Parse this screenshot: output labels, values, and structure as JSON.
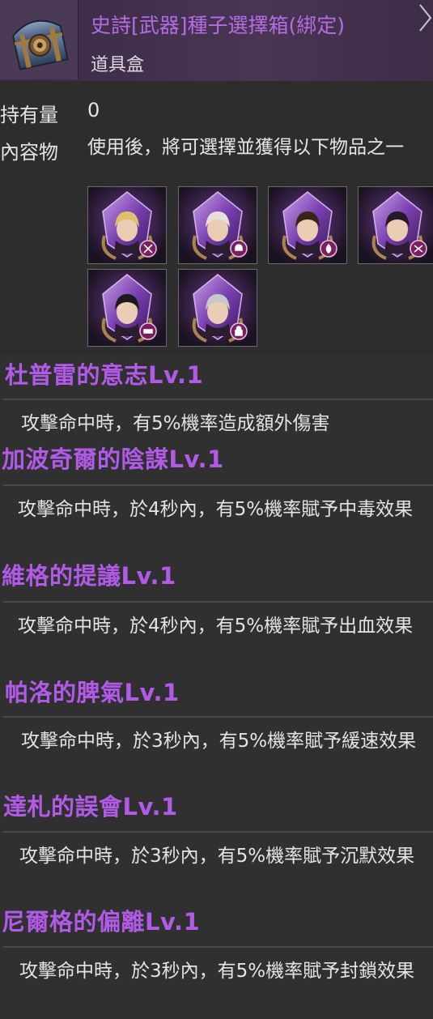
{
  "header": {
    "title": "史詩[武器]種子選擇箱(綁定)",
    "item_type": "道具盒",
    "icon": "treasure-chest-icon",
    "close_icon": "chevron-right-icon"
  },
  "info": {
    "quantity_label": "持有量",
    "quantity_value": "0",
    "contents_label": "內容物",
    "contents_desc": "使用後，將可選擇並獲得以下物品之一"
  },
  "slots": [
    {
      "portrait": "blonde-warrior",
      "badge": "sword-icon"
    },
    {
      "portrait": "white-hair-mage",
      "badge": "skull-icon"
    },
    {
      "portrait": "dark-hair-rogue",
      "badge": "drop-icon"
    },
    {
      "portrait": "dark-lady",
      "badge": "bone-icon"
    },
    {
      "portrait": "black-hair-man",
      "badge": "mute-icon"
    },
    {
      "portrait": "silver-hair-man",
      "badge": "lock-icon"
    }
  ],
  "options": [
    {
      "name": "杜普雷的意志Lv.1",
      "desc": "攻擊命中時，有5%機率造成額外傷害"
    },
    {
      "name": "加波奇爾的陰謀Lv.1",
      "desc": "攻擊命中時，於4秒內，有5%機率賦予中毒效果"
    },
    {
      "name": "維格的提議Lv.1",
      "desc": "攻擊命中時，於4秒內，有5%機率賦予出血效果"
    },
    {
      "name": "帕洛的脾氣Lv.1",
      "desc": "攻擊命中時，於3秒內，有5%機率賦予緩速效果"
    },
    {
      "name": "達札的誤會Lv.1",
      "desc": "攻擊命中時，於3秒內，有5%機率賦予沉默效果"
    },
    {
      "name": "尼爾格的偏離Lv.1",
      "desc": "攻擊命中時，於3秒內，有5%機率賦予封鎖效果"
    }
  ],
  "colors": {
    "option_name": "#b25ae8",
    "title": "#b46de0",
    "text": "#e4e4e4"
  }
}
